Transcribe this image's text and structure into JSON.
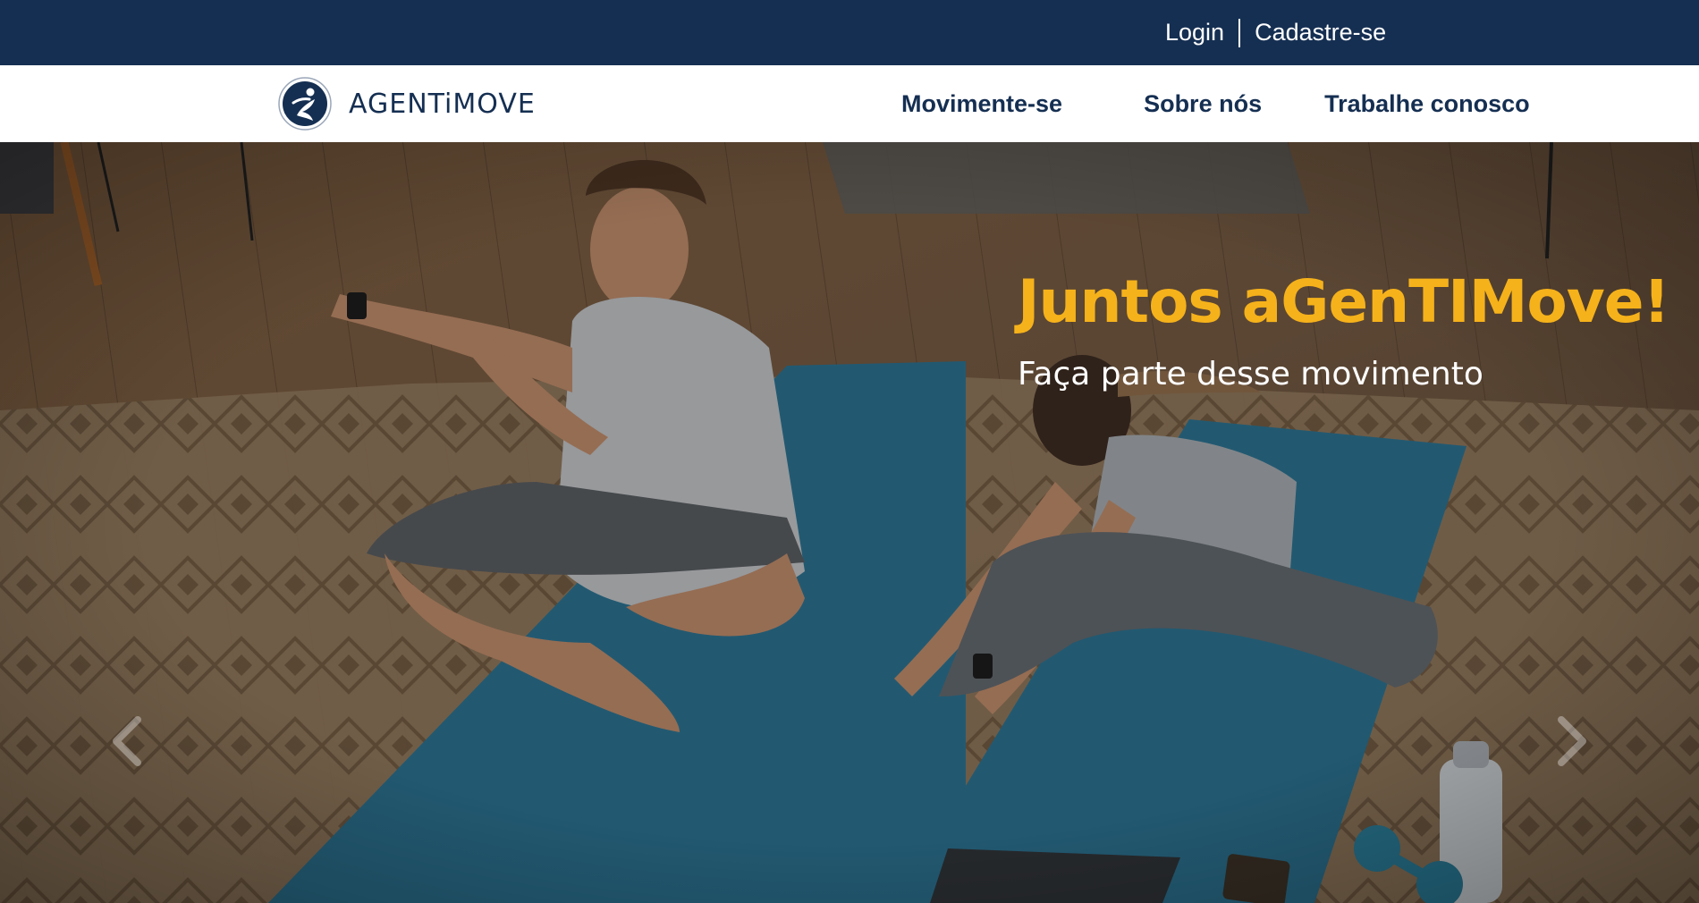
{
  "topbar": {
    "login_label": "Login",
    "signup_label": "Cadastre-se"
  },
  "brand": {
    "name": "AGENTiMOVE",
    "logo_icon": "runner-circle-icon"
  },
  "nav": {
    "items": [
      {
        "label": "Movimente-se"
      },
      {
        "label": "Sobre nós"
      },
      {
        "label": "Trabalhe conosco"
      }
    ]
  },
  "hero": {
    "title": "Juntos aGenTIMove!",
    "subtitle": "Faça parte desse movimento",
    "image_description_icon": "yoga-stretching-couple-photo",
    "prev_icon": "chevron-left-icon",
    "next_icon": "chevron-right-icon"
  },
  "colors": {
    "navy": "#152f52",
    "accent": "#f6b21a",
    "white": "#ffffff"
  }
}
